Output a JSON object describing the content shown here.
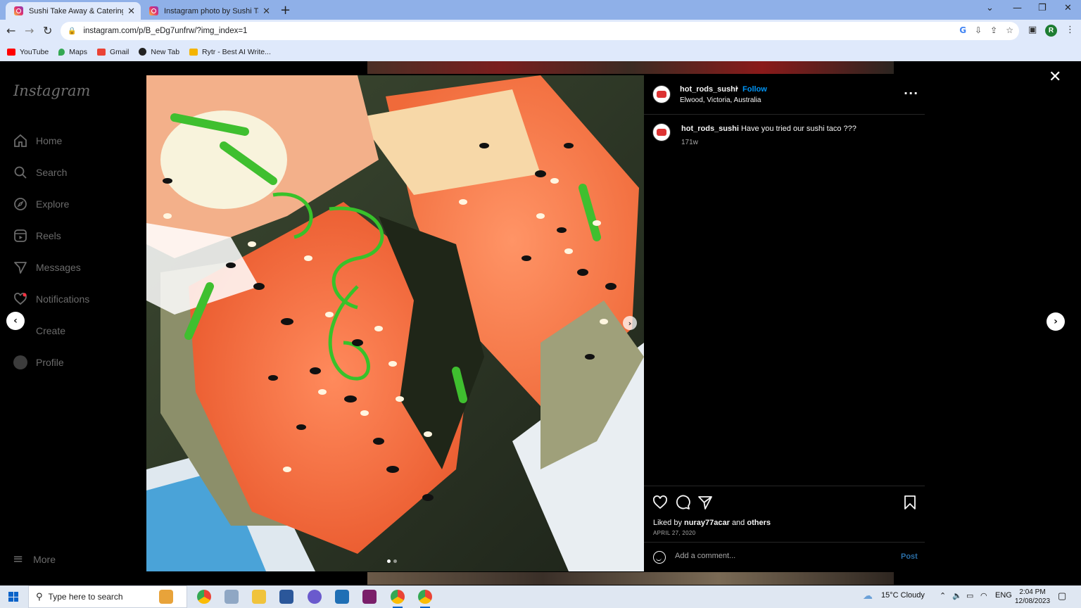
{
  "browser": {
    "tabs": [
      {
        "title": "Sushi Take Away & Catering (@h",
        "active": true
      },
      {
        "title": "Instagram photo by Sushi Take A",
        "active": false
      }
    ],
    "url": "instagram.com/p/B_eDg7unfrw/?img_index=1",
    "profile_initial": "R",
    "bookmarks": [
      {
        "label": "YouTube",
        "icon": "youtube-icon",
        "color": "#ff0000"
      },
      {
        "label": "Maps",
        "icon": "maps-icon",
        "color": "#34a853"
      },
      {
        "label": "Gmail",
        "icon": "gmail-icon",
        "color": "#ea4335"
      },
      {
        "label": "New Tab",
        "icon": "globe-icon",
        "color": "#222222"
      },
      {
        "label": "Rytr - Best AI Write...",
        "icon": "rytr-icon",
        "color": "#f4b400"
      }
    ]
  },
  "instagram": {
    "logo": "Instagram",
    "nav": [
      {
        "label": "Home",
        "icon": "home-icon"
      },
      {
        "label": "Search",
        "icon": "search-icon"
      },
      {
        "label": "Explore",
        "icon": "explore-icon"
      },
      {
        "label": "Reels",
        "icon": "reels-icon"
      },
      {
        "label": "Messages",
        "icon": "messages-icon"
      },
      {
        "label": "Notifications",
        "icon": "heart-icon"
      },
      {
        "label": "Create",
        "icon": "create-icon"
      },
      {
        "label": "Profile",
        "icon": "profile-icon"
      }
    ],
    "more": "More"
  },
  "post": {
    "username": "hot_rods_sushi",
    "separator": "•",
    "follow": "Follow",
    "location": "Elwood, Victoria, Australia",
    "caption_user": "hot_rods_sushi",
    "caption": "Have you tried our sushi taco ???",
    "age": "171w",
    "liked_prefix": "Liked by",
    "liked_user": "nuray77acar",
    "liked_and": "and",
    "liked_others": "others",
    "date": "APRIL 27, 2020",
    "comment_placeholder": "Add a comment...",
    "post_label": "Post",
    "image_count": 2,
    "current_image": 1
  },
  "taskbar": {
    "search_placeholder": "Type here to search",
    "weather": "15°C  Cloudy",
    "lang": "ENG",
    "time": "2:04 PM",
    "date": "12/08/2023"
  }
}
